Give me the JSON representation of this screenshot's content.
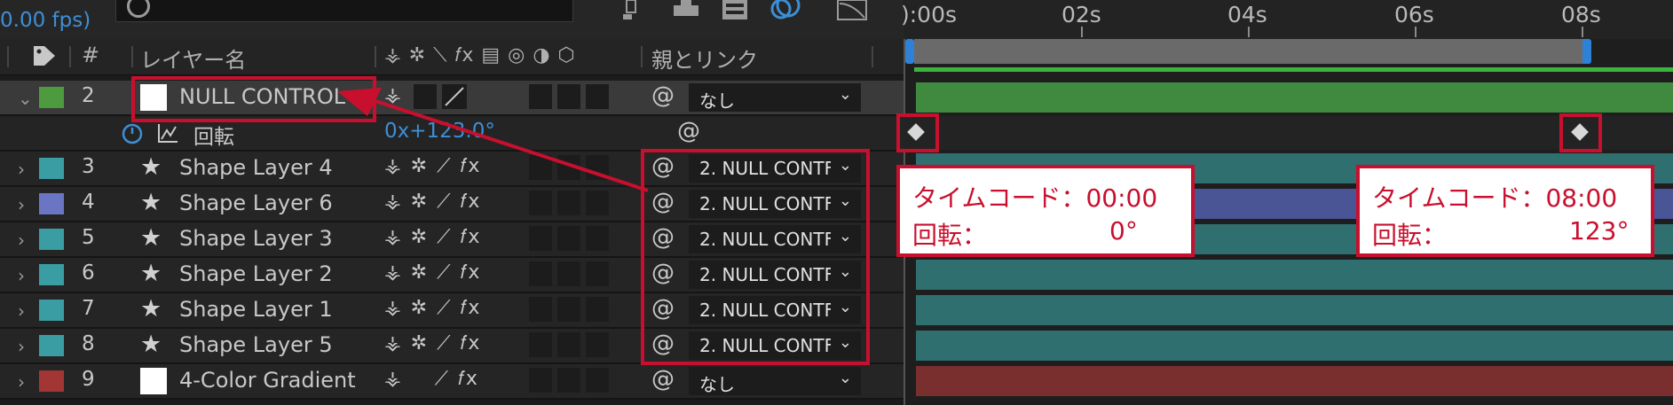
{
  "header": {
    "fps": "0.00 fps)"
  },
  "ruler": {
    "labels": [
      "):00s",
      "02s",
      "04s",
      "06s",
      "08s"
    ]
  },
  "columns": {
    "layer_name": "レイヤー名",
    "hash": "#",
    "parent_link": "親とリンク"
  },
  "layers": [
    {
      "num": "2",
      "name": "NULL CONTROL",
      "color": "#4e9a3e",
      "kind": "solid",
      "parent": "なし"
    },
    {
      "num": "3",
      "name": "Shape Layer 4",
      "color": "#3a9da3",
      "kind": "shape",
      "parent": "2. NULL CONTF"
    },
    {
      "num": "4",
      "name": "Shape Layer 6",
      "color": "#6a76c4",
      "kind": "shape",
      "parent": "2. NULL CONTF"
    },
    {
      "num": "5",
      "name": "Shape Layer 3",
      "color": "#3a9da3",
      "kind": "shape",
      "parent": "2. NULL CONTF"
    },
    {
      "num": "6",
      "name": "Shape Layer 2",
      "color": "#3a9da3",
      "kind": "shape",
      "parent": "2. NULL CONTF"
    },
    {
      "num": "7",
      "name": "Shape Layer 1",
      "color": "#3a9da3",
      "kind": "shape",
      "parent": "2. NULL CONTF"
    },
    {
      "num": "8",
      "name": "Shape Layer 5",
      "color": "#3a9da3",
      "kind": "shape",
      "parent": "2. NULL CONTF"
    },
    {
      "num": "9",
      "name": "4-Color Gradient",
      "color": "#a33535",
      "kind": "solid",
      "parent": "なし"
    }
  ],
  "property": {
    "name": "回転",
    "value": "0x+123.0°"
  },
  "callouts": {
    "left": {
      "line1": "タイムコード：00:00",
      "line2_label": "回転：",
      "line2_value": "0°"
    },
    "right": {
      "line1": "タイムコード：08:00",
      "line2_label": "回転：",
      "line2_value": "123°"
    }
  },
  "track_colors": {
    "green": "#3f8a3f",
    "teal": "#2f6f6f",
    "blue": "#4a5595",
    "red": "#7a2f2f"
  }
}
